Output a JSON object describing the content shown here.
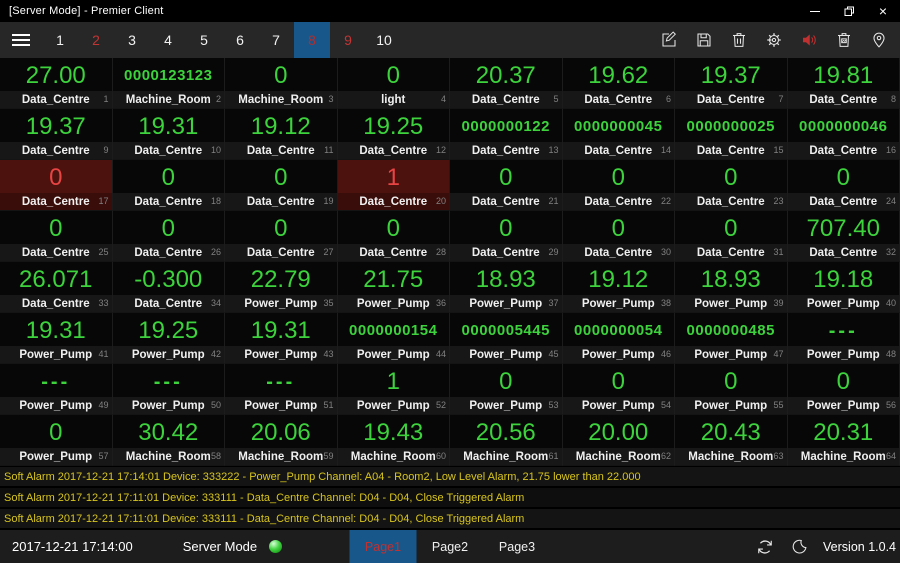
{
  "window": {
    "title": "[Server Mode] - Premier Client"
  },
  "toolbar": {
    "tabs": [
      {
        "label": "1"
      },
      {
        "label": "2",
        "red": true
      },
      {
        "label": "3"
      },
      {
        "label": "4"
      },
      {
        "label": "5"
      },
      {
        "label": "6"
      },
      {
        "label": "7"
      },
      {
        "label": "8",
        "active": true
      },
      {
        "label": "9",
        "red": true
      },
      {
        "label": "10"
      }
    ],
    "icons": [
      "edit-icon",
      "save-icon",
      "delete-icon",
      "settings-icon",
      "speaker-icon",
      "image-delete-icon",
      "location-icon"
    ]
  },
  "colors": {
    "accent_blue": "#17578a",
    "value_green": "#3dd33d",
    "alarm_value_red": "#e74444",
    "alarm_cell_bg": "#4c120e",
    "alarm_text_yellow": "#d8c51e",
    "tab_red": "#c23535",
    "indicator_green": "#44d544"
  },
  "grid": {
    "cells": [
      {
        "value": "27.00",
        "label": "Data_Centre",
        "index": "1"
      },
      {
        "value": "0000123123",
        "label": "Machine_Room",
        "index": "2",
        "small": true
      },
      {
        "value": "0",
        "label": "Machine_Room",
        "index": "3"
      },
      {
        "value": "0",
        "label": "light",
        "index": "4"
      },
      {
        "value": "20.37",
        "label": "Data_Centre",
        "index": "5"
      },
      {
        "value": "19.62",
        "label": "Data_Centre",
        "index": "6"
      },
      {
        "value": "19.37",
        "label": "Data_Centre",
        "index": "7"
      },
      {
        "value": "19.81",
        "label": "Data_Centre",
        "index": "8"
      },
      {
        "value": "19.37",
        "label": "Data_Centre",
        "index": "9"
      },
      {
        "value": "19.31",
        "label": "Data_Centre",
        "index": "10"
      },
      {
        "value": "19.12",
        "label": "Data_Centre",
        "index": "11"
      },
      {
        "value": "19.25",
        "label": "Data_Centre",
        "index": "12"
      },
      {
        "value": "0000000122",
        "label": "Data_Centre",
        "index": "13",
        "small": true
      },
      {
        "value": "0000000045",
        "label": "Data_Centre",
        "index": "14",
        "small": true
      },
      {
        "value": "0000000025",
        "label": "Data_Centre",
        "index": "15",
        "small": true
      },
      {
        "value": "0000000046",
        "label": "Data_Centre",
        "index": "16",
        "small": true
      },
      {
        "value": "0",
        "label": "Data_Centre",
        "index": "17",
        "alarm": true
      },
      {
        "value": "0",
        "label": "Data_Centre",
        "index": "18"
      },
      {
        "value": "0",
        "label": "Data_Centre",
        "index": "19"
      },
      {
        "value": "1",
        "label": "Data_Centre",
        "index": "20",
        "alarm": true
      },
      {
        "value": "0",
        "label": "Data_Centre",
        "index": "21"
      },
      {
        "value": "0",
        "label": "Data_Centre",
        "index": "22"
      },
      {
        "value": "0",
        "label": "Data_Centre",
        "index": "23"
      },
      {
        "value": "0",
        "label": "Data_Centre",
        "index": "24"
      },
      {
        "value": "0",
        "label": "Data_Centre",
        "index": "25"
      },
      {
        "value": "0",
        "label": "Data_Centre",
        "index": "26"
      },
      {
        "value": "0",
        "label": "Data_Centre",
        "index": "27"
      },
      {
        "value": "0",
        "label": "Data_Centre",
        "index": "28"
      },
      {
        "value": "0",
        "label": "Data_Centre",
        "index": "29"
      },
      {
        "value": "0",
        "label": "Data_Centre",
        "index": "30"
      },
      {
        "value": "0",
        "label": "Data_Centre",
        "index": "31"
      },
      {
        "value": "707.40",
        "label": "Data_Centre",
        "index": "32"
      },
      {
        "value": "26.071",
        "label": "Data_Centre",
        "index": "33"
      },
      {
        "value": "-0.300",
        "label": "Data_Centre",
        "index": "34"
      },
      {
        "value": "22.79",
        "label": "Power_Pump",
        "index": "35"
      },
      {
        "value": "21.75",
        "label": "Power_Pump",
        "index": "36"
      },
      {
        "value": "18.93",
        "label": "Power_Pump",
        "index": "37"
      },
      {
        "value": "19.12",
        "label": "Power_Pump",
        "index": "38"
      },
      {
        "value": "18.93",
        "label": "Power_Pump",
        "index": "39"
      },
      {
        "value": "19.18",
        "label": "Power_Pump",
        "index": "40"
      },
      {
        "value": "19.31",
        "label": "Power_Pump",
        "index": "41"
      },
      {
        "value": "19.25",
        "label": "Power_Pump",
        "index": "42"
      },
      {
        "value": "19.31",
        "label": "Power_Pump",
        "index": "43"
      },
      {
        "value": "0000000154",
        "label": "Power_Pump",
        "index": "44",
        "small": true
      },
      {
        "value": "0000005445",
        "label": "Power_Pump",
        "index": "45",
        "small": true
      },
      {
        "value": "0000000054",
        "label": "Power_Pump",
        "index": "46",
        "small": true
      },
      {
        "value": "0000000485",
        "label": "Power_Pump",
        "index": "47",
        "small": true
      },
      {
        "value": "---",
        "label": "Power_Pump",
        "index": "48",
        "dash": true
      },
      {
        "value": "---",
        "label": "Power_Pump",
        "index": "49",
        "dash": true
      },
      {
        "value": "---",
        "label": "Power_Pump",
        "index": "50",
        "dash": true
      },
      {
        "value": "---",
        "label": "Power_Pump",
        "index": "51",
        "dash": true
      },
      {
        "value": "1",
        "label": "Power_Pump",
        "index": "52"
      },
      {
        "value": "0",
        "label": "Power_Pump",
        "index": "53"
      },
      {
        "value": "0",
        "label": "Power_Pump",
        "index": "54"
      },
      {
        "value": "0",
        "label": "Power_Pump",
        "index": "55"
      },
      {
        "value": "0",
        "label": "Power_Pump",
        "index": "56"
      },
      {
        "value": "0",
        "label": "Power_Pump",
        "index": "57"
      },
      {
        "value": "30.42",
        "label": "Machine_Room",
        "index": "58"
      },
      {
        "value": "20.06",
        "label": "Machine_Room",
        "index": "59"
      },
      {
        "value": "19.43",
        "label": "Machine_Room",
        "index": "60"
      },
      {
        "value": "20.56",
        "label": "Machine_Room",
        "index": "61"
      },
      {
        "value": "20.00",
        "label": "Machine_Room",
        "index": "62"
      },
      {
        "value": "20.43",
        "label": "Machine_Room",
        "index": "63"
      },
      {
        "value": "20.31",
        "label": "Machine_Room",
        "index": "64"
      }
    ]
  },
  "alarms": [
    "Soft Alarm 2017-12-21 17:14:01 Device: 333222 - Power_Pump Channel: A04 - Room2, Low Level Alarm, 21.75 lower than 22.000",
    "Soft Alarm 2017-12-21 17:11:01 Device: 333111 - Data_Centre Channel: D04 - D04, Close Triggered Alarm",
    "Soft Alarm 2017-12-21 17:11:01 Device: 333111 - Data_Centre Channel: D04 - D04, Close Triggered Alarm"
  ],
  "statusbar": {
    "datetime": "2017-12-21 17:14:00",
    "mode_label": "Server Mode",
    "pages": [
      {
        "label": "Page1",
        "active": true
      },
      {
        "label": "Page2"
      },
      {
        "label": "Page3"
      }
    ],
    "version": "Version 1.0.4"
  }
}
